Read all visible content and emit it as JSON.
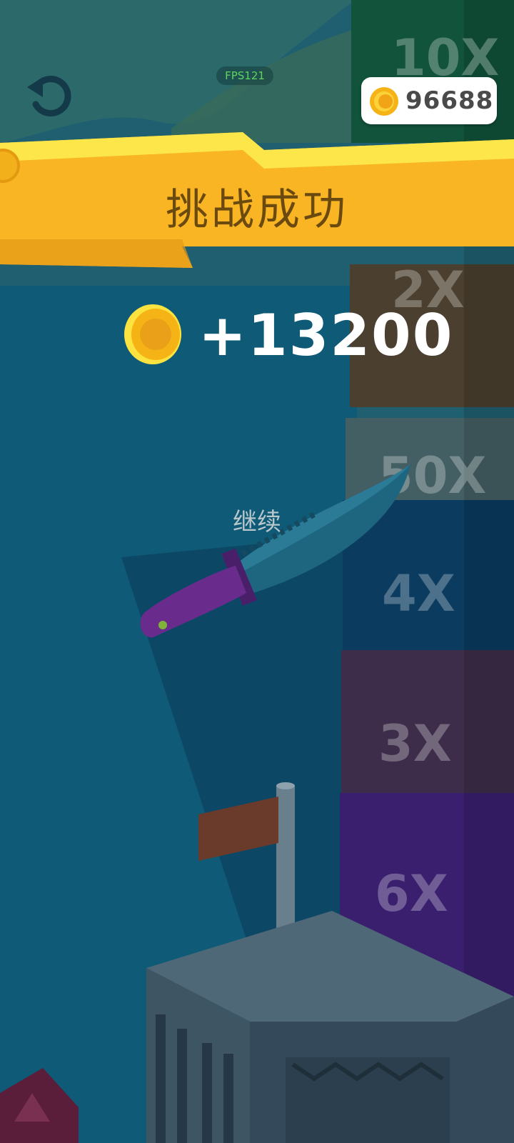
{
  "hud": {
    "fps_label": "FPS121",
    "coin_total": "96688",
    "restart_icon": "restart-arrow-icon"
  },
  "banner": {
    "title": "挑战成功"
  },
  "reward": {
    "amount": "+13200",
    "coin_icon": "coin-icon"
  },
  "continue_label": "继续",
  "tower": {
    "multipliers": [
      "10X",
      "2X",
      "50X",
      "4X",
      "3X",
      "6X"
    ]
  },
  "colors": {
    "banner_yellow": "#fbbf2a",
    "coin_gold": "#f5b316",
    "sky": "#1f6071",
    "knife_handle": "#6a2c8c"
  }
}
